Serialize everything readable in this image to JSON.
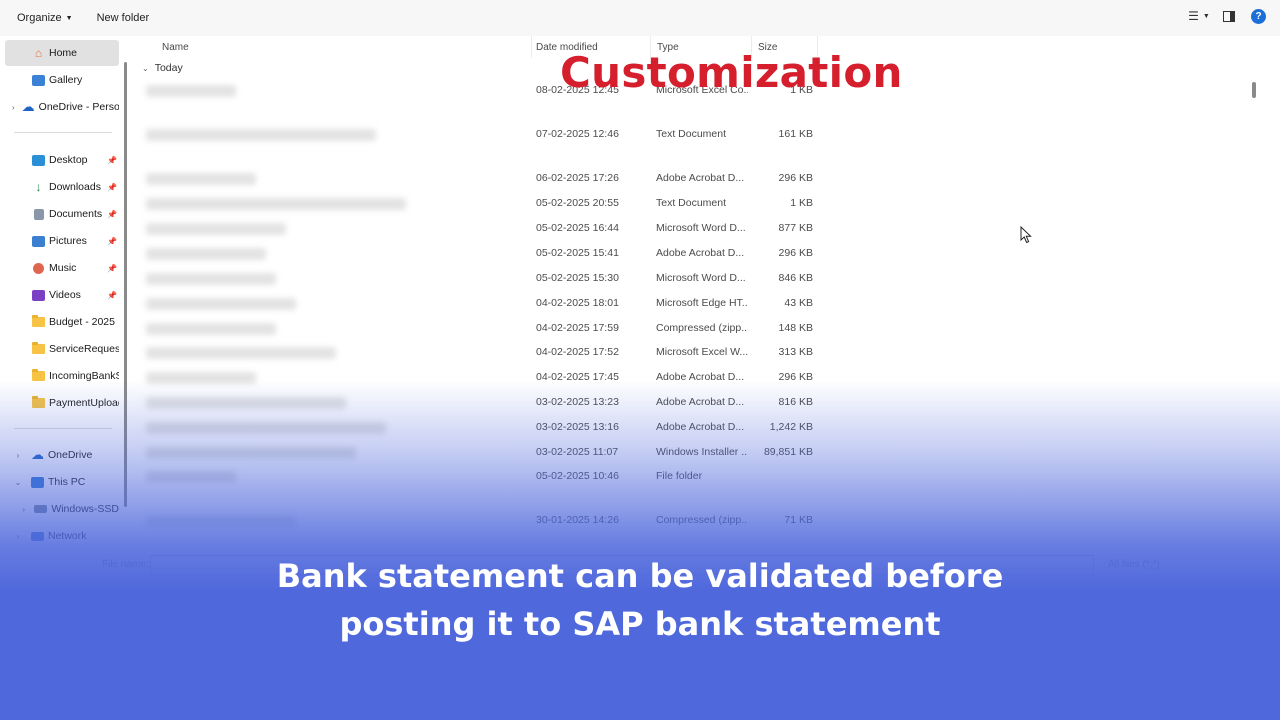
{
  "toolbar": {
    "organize_label": "Organize",
    "new_folder_label": "New folder"
  },
  "sidebar": {
    "quick": [
      {
        "label": "Home",
        "icon": "home-icon",
        "selected": true
      },
      {
        "label": "Gallery",
        "icon": "gallery-icon"
      },
      {
        "label": "OneDrive - Perso",
        "icon": "onedrive-icon",
        "expandable": true
      }
    ],
    "pinned": [
      {
        "label": "Desktop",
        "icon": "desktop-icon",
        "pinned": true
      },
      {
        "label": "Downloads",
        "icon": "download-icon",
        "pinned": true
      },
      {
        "label": "Documents",
        "icon": "documents-icon",
        "pinned": true
      },
      {
        "label": "Pictures",
        "icon": "pictures-icon",
        "pinned": true
      },
      {
        "label": "Music",
        "icon": "music-icon",
        "pinned": true
      },
      {
        "label": "Videos",
        "icon": "videos-icon",
        "pinned": true
      },
      {
        "label": "Budget - 2025",
        "icon": "folder-icon"
      },
      {
        "label": "ServiceRequestS",
        "icon": "folder-icon"
      },
      {
        "label": "IncomingBankSt",
        "icon": "folder-icon"
      },
      {
        "label": "PaymentUpload",
        "icon": "folder-icon"
      }
    ],
    "tree": [
      {
        "label": "OneDrive",
        "icon": "onedrive-icon",
        "chevron": ">"
      },
      {
        "label": "This PC",
        "icon": "pc-icon",
        "chevron": "v"
      },
      {
        "label": "Windows-SSD",
        "icon": "drive-icon",
        "chevron": ">"
      },
      {
        "label": "Network",
        "icon": "network-icon",
        "chevron": ">"
      }
    ]
  },
  "columns": {
    "name": "Name",
    "date": "Date modified",
    "type": "Type",
    "size": "Size"
  },
  "group_label": "Today",
  "files": [
    {
      "date": "08-02-2025 12:45",
      "type": "Microsoft Excel Co...",
      "size": "1 KB"
    },
    {
      "date": "07-02-2025 12:46",
      "type": "Text Document",
      "size": "161 KB"
    },
    {
      "date": "06-02-2025 17:26",
      "type": "Adobe Acrobat D...",
      "size": "296 KB"
    },
    {
      "date": "05-02-2025 20:55",
      "type": "Text Document",
      "size": "1 KB"
    },
    {
      "date": "05-02-2025 16:44",
      "type": "Microsoft Word D...",
      "size": "877 KB"
    },
    {
      "date": "05-02-2025 15:41",
      "type": "Adobe Acrobat D...",
      "size": "296 KB"
    },
    {
      "date": "05-02-2025 15:30",
      "type": "Microsoft Word D...",
      "size": "846 KB"
    },
    {
      "date": "04-02-2025 18:01",
      "type": "Microsoft Edge HT...",
      "size": "43 KB"
    },
    {
      "date": "04-02-2025 17:59",
      "type": "Compressed (zipp...",
      "size": "148 KB"
    },
    {
      "date": "04-02-2025 17:52",
      "type": "Microsoft Excel W...",
      "size": "313 KB"
    },
    {
      "date": "04-02-2025 17:45",
      "type": "Adobe Acrobat D...",
      "size": "296 KB"
    },
    {
      "date": "03-02-2025 13:23",
      "type": "Adobe Acrobat D...",
      "size": "816 KB"
    },
    {
      "date": "03-02-2025 13:16",
      "type": "Adobe Acrobat D...",
      "size": "1,242 KB"
    },
    {
      "date": "03-02-2025 11:07",
      "type": "Windows Installer ...",
      "size": "89,851 KB"
    },
    {
      "date": "05-02-2025 10:46",
      "type": "File folder",
      "size": ""
    },
    {
      "date": "30-01-2025 14:26",
      "type": "Compressed (zipp...",
      "size": "71 KB"
    }
  ],
  "filename_label": "File name:",
  "filetype_label": "All files (*.*)",
  "overlay": {
    "title": "Customization",
    "caption_line1": "Bank statement can be validated before",
    "caption_line2": "posting it to SAP bank statement"
  },
  "colors": {
    "title": "#d51f2d",
    "caption_band": "#4f68dc",
    "caption_text": "#ffffff"
  }
}
